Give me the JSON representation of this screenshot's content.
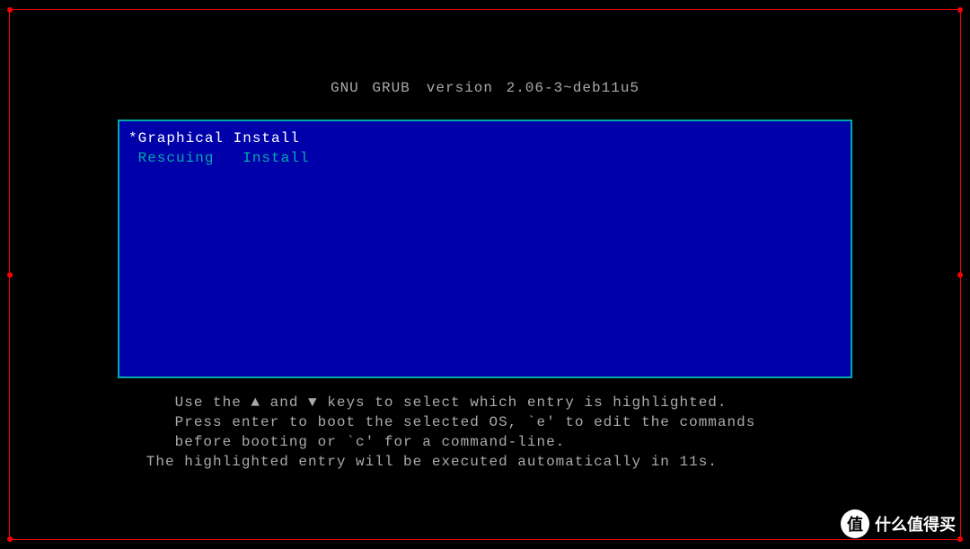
{
  "header": {
    "product": "GNU GRUB",
    "version_label": "version 2.06-3~deb11u5"
  },
  "menu": {
    "entries": [
      {
        "label": "*Graphical Install",
        "selected": true
      },
      {
        "label": " Rescuing   Install",
        "selected": false
      }
    ]
  },
  "help": {
    "line1": "      Use the ▲ and ▼ keys to select which entry is highlighted.",
    "line2": "      Press enter to boot the selected OS, `e' to edit the commands",
    "line3": "      before booting or `c' for a command-line.",
    "line4": "   The highlighted entry will be executed automatically in 11s."
  },
  "watermark": {
    "badge": "值",
    "text": "什么值得买"
  }
}
